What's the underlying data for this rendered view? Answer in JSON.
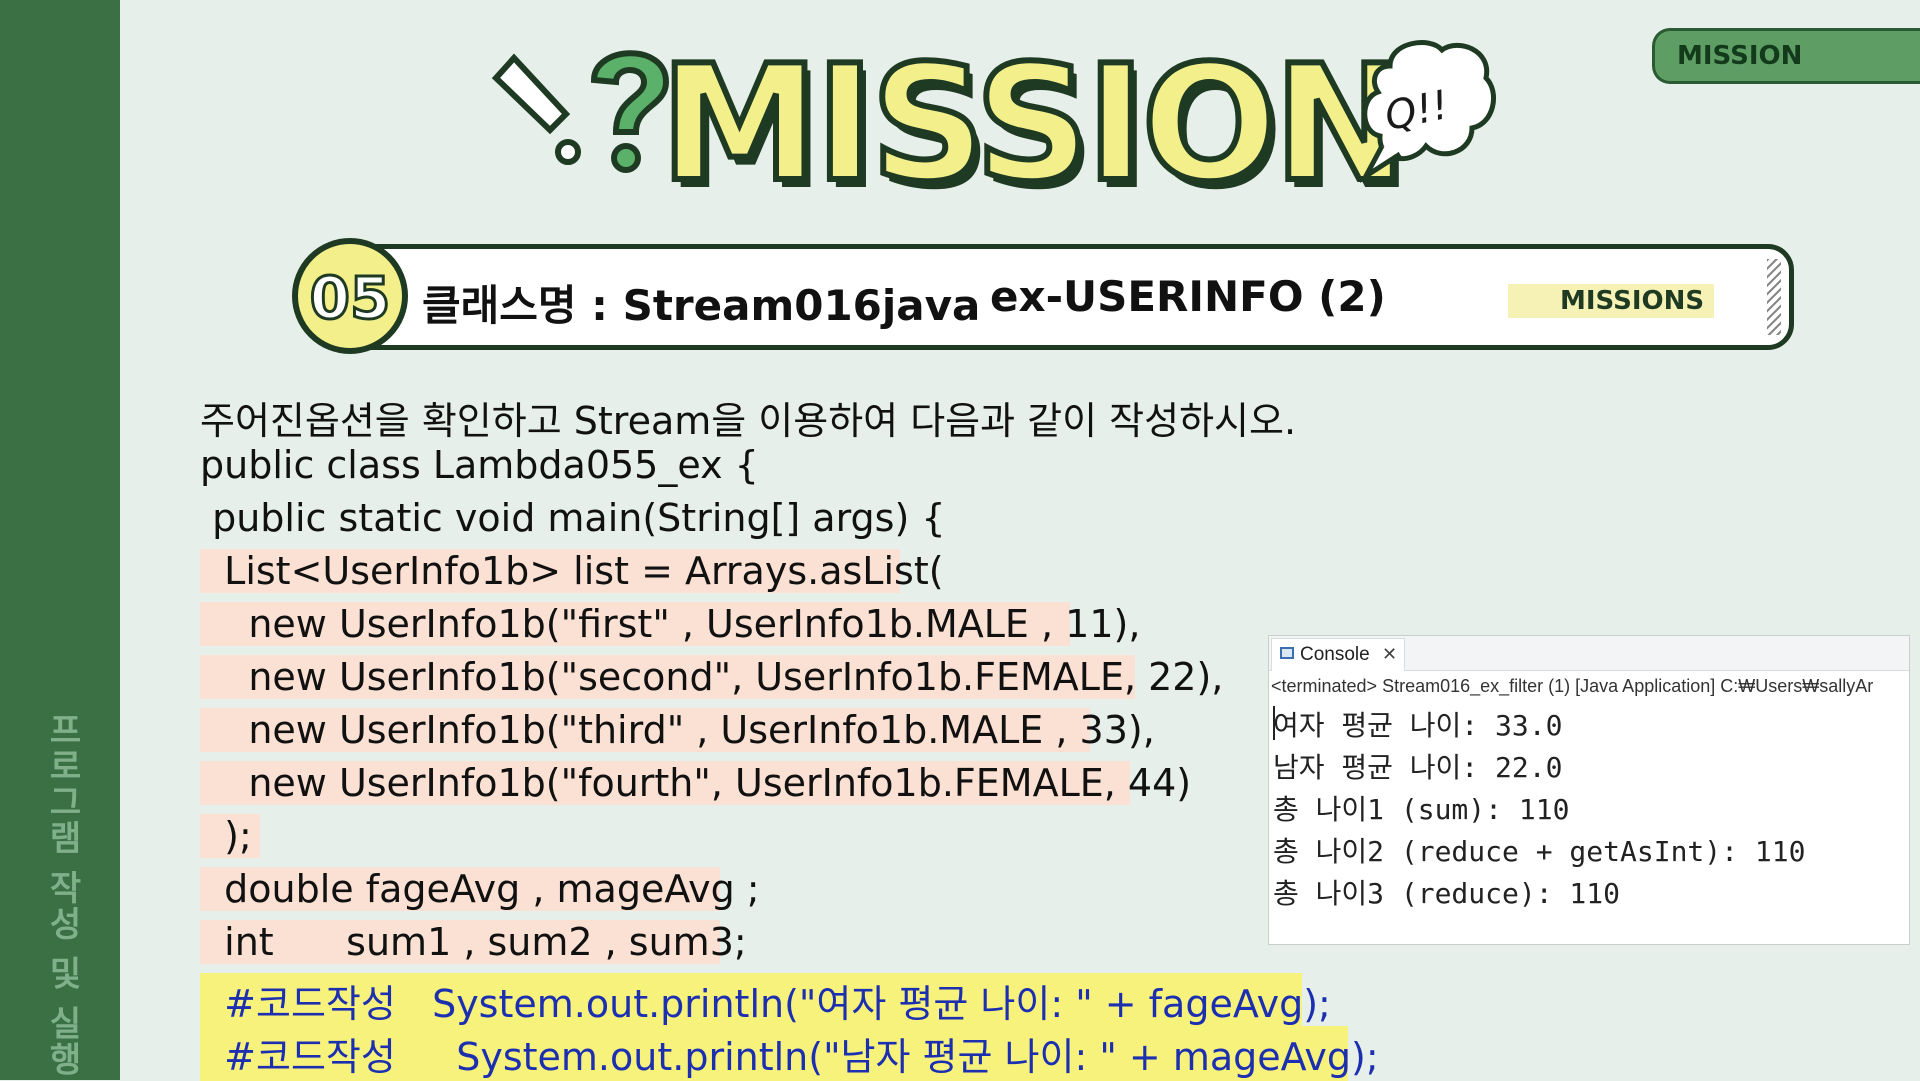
{
  "sidebar": {
    "label": "프로그램 작성 및 실행"
  },
  "tab": {
    "label": "MISSION"
  },
  "hero": {
    "title": "MISSION",
    "bubble_text": "Q!!"
  },
  "banner": {
    "number": "05",
    "class_label": "클래스명 : Stream016java",
    "ex_label": "ex-USERINFO  (2)",
    "missions_tag": "MISSIONS"
  },
  "instruction": "주어진옵션을 확인하고 Stream을 이용하여 다음과 같이 작성하시오.",
  "code": {
    "line1": "public class Lambda055_ex {",
    "line2": " public static void main(String[] args) {",
    "line3": "  List<UserInfo1b> list = Arrays.asList(",
    "line4": "    new UserInfo1b(\"first\" , UserInfo1b.MALE , 11),",
    "line5": "    new UserInfo1b(\"second\", UserInfo1b.FEMALE, 22),",
    "line6": "    new UserInfo1b(\"third\" , UserInfo1b.MALE , 33),",
    "line7": "    new UserInfo1b(\"fourth\", UserInfo1b.FEMALE, 44)",
    "line8": "  );",
    "line9": "  double fageAvg , mageAvg ;",
    "line10": "  int      sum1 , sum2 , sum3;",
    "line11": "  #코드작성   System.out.println(\"여자 평균 나이: \" + fageAvg);",
    "line12": "  #코드작성     System.out.println(\"남자 평균 나이: \" + mageAvg);"
  },
  "console": {
    "tab_label": "Console",
    "close_symbol": "✕",
    "path": "<terminated> Stream016_ex_filter (1) [Java Application] C:₩Users₩sallyAr",
    "lines": [
      "여자 평균 나이: 33.0",
      "남자 평균 나이: 22.0",
      "총 나이1 (sum): 110",
      "총 나이2 (reduce + getAsInt): 110",
      "총 나이3 (reduce): 110"
    ]
  },
  "colors": {
    "accent_green": "#3a7043",
    "title_yellow": "#f3f08c",
    "highlight_pink": "#fbe1d3",
    "highlight_yellow": "#f6f27c",
    "code_blue": "#1c2fb0"
  }
}
